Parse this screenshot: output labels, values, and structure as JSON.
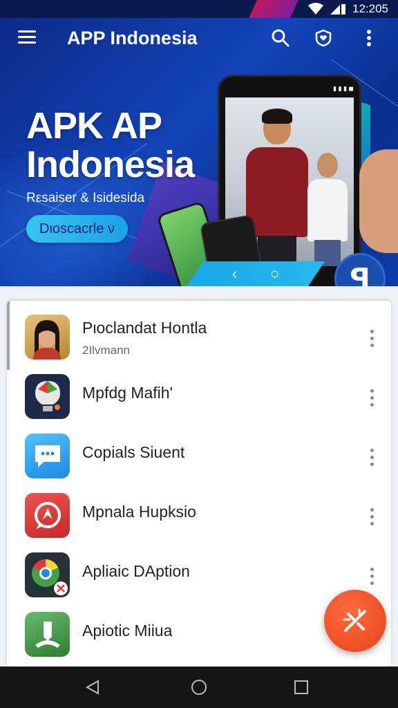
{
  "status_bar": {
    "time": "12:205"
  },
  "app_bar": {
    "title": "APP Indonesia",
    "icons": [
      "menu-icon",
      "search-icon",
      "heart-shield-icon",
      "more-vert-icon"
    ]
  },
  "hero": {
    "headline_line1": "APK AP",
    "headline_line2": "Indonesia",
    "subtitle": "Rεsaiser & Isidesida",
    "button_label": "Dιoscacrle ν",
    "colors": {
      "bg": "#1244b8",
      "button": "#1da1e8"
    }
  },
  "apps": [
    {
      "name": "Pιoclandat Hontla",
      "meta": "2Ilvmann",
      "icon": "person-photo-icon"
    },
    {
      "name": "Mpfdg Mafih'",
      "meta": "",
      "icon": "bulb-app-icon"
    },
    {
      "name": "Copials Siuent",
      "meta": "",
      "icon": "chat-bubble-icon"
    },
    {
      "name": "Mpnala Hupksio",
      "meta": "",
      "icon": "red-chat-icon"
    },
    {
      "name": "Apliaic DAption",
      "meta": "",
      "icon": "browser-app-icon"
    },
    {
      "name": "Apiotic Miiua",
      "meta": "",
      "icon": "green-app-icon"
    }
  ],
  "fab": {
    "icon": "sparkle-tool-icon",
    "color": "#e8421a"
  },
  "system_nav": [
    "back-icon",
    "home-icon",
    "recents-icon"
  ]
}
